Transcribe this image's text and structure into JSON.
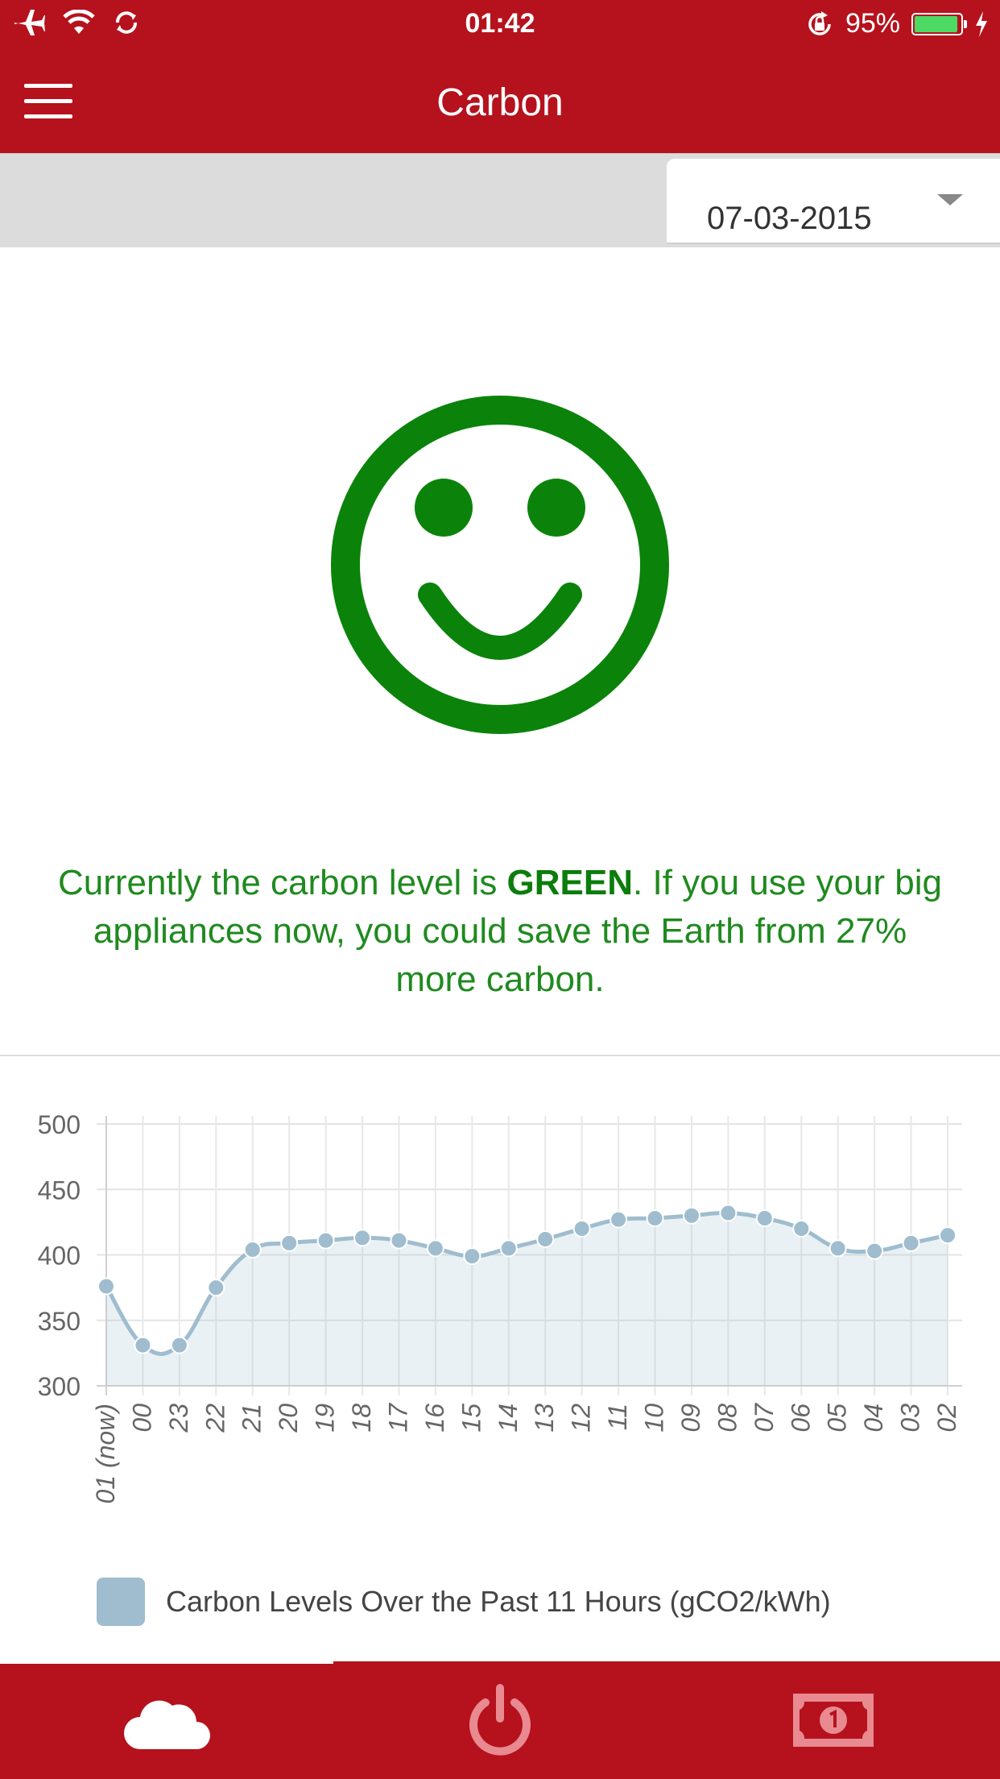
{
  "status_bar": {
    "time": "01:42",
    "battery": "95%",
    "battery_level": 0.95,
    "icons": [
      "airplane-icon",
      "wifi-icon",
      "sync-icon",
      "rotation-lock-icon",
      "charging-icon"
    ]
  },
  "nav": {
    "title": "Carbon",
    "menu_icon": "hamburger-icon"
  },
  "date_picker": {
    "value": "07-03-2015"
  },
  "status_face": {
    "icon": "smiley-face-icon",
    "color": "#0b830b"
  },
  "message": {
    "prefix": "Currently the carbon level is ",
    "level": "GREEN",
    "suffix": ". If you use your big appliances now, you could save the Earth from 27% more carbon."
  },
  "chart_data": {
    "type": "line",
    "categories": [
      "01 (now)",
      "00",
      "23",
      "22",
      "21",
      "20",
      "19",
      "18",
      "17",
      "16",
      "15",
      "14",
      "13",
      "12",
      "11",
      "10",
      "09",
      "08",
      "07",
      "06",
      "05",
      "04",
      "03",
      "02"
    ],
    "series": [
      {
        "name": "Carbon Levels Over the Past 11 Hours (gCO2/kWh)",
        "values": [
          376,
          331,
          331,
          375,
          404,
          409,
          411,
          413,
          411,
          405,
          399,
          405,
          412,
          420,
          427,
          428,
          430,
          432,
          428,
          420,
          405,
          403,
          409,
          415
        ]
      }
    ],
    "y_ticks": [
      "500",
      "450",
      "400",
      "350",
      "300"
    ],
    "ylim": [
      300,
      500
    ],
    "grid": true,
    "area_fill": true,
    "color": "#9fbdcf",
    "legend_position": "bottom"
  },
  "tabs": [
    {
      "name": "carbon",
      "icon": "cloud-icon",
      "active": true
    },
    {
      "name": "power",
      "icon": "power-icon",
      "active": false
    },
    {
      "name": "money",
      "icon": "banknote-icon",
      "active": false
    }
  ],
  "colors": {
    "brand": "#b5121d",
    "green_text": "#0b7d0b",
    "series": "#9fbdcf"
  }
}
